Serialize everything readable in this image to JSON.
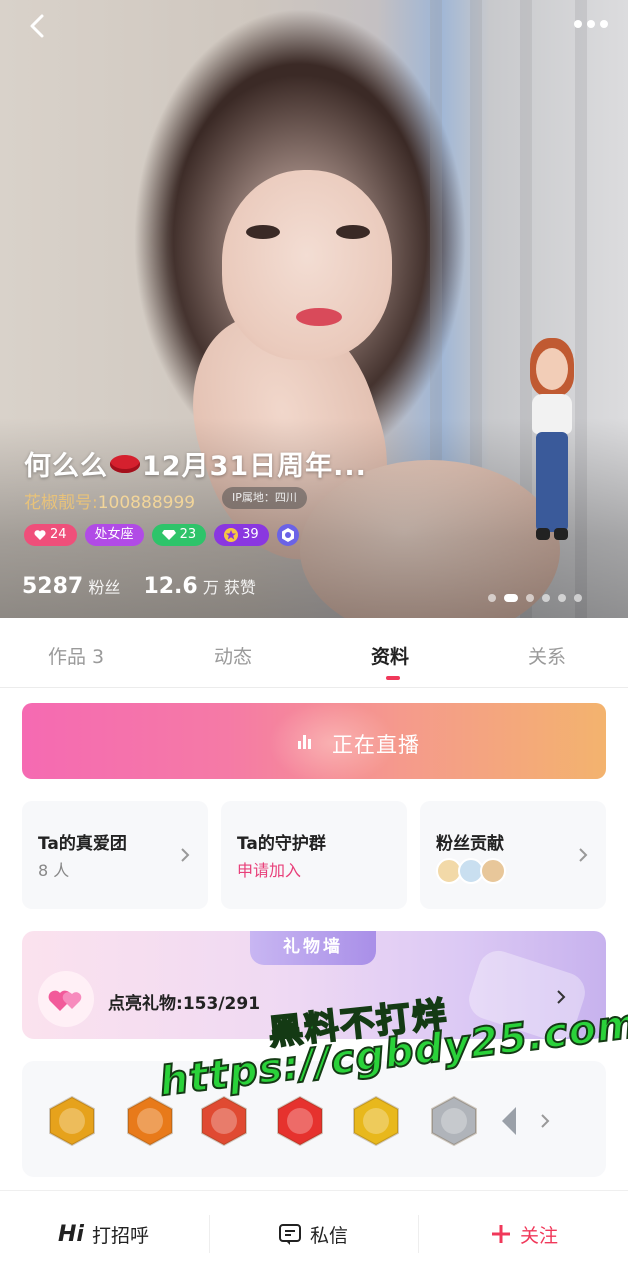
{
  "header": {
    "back_icon": "chevron-left-icon",
    "more_icon": "more-dots-icon"
  },
  "profile": {
    "name_part1": "何么么",
    "name_emoji": "lips",
    "name_part2": "12月31日周年...",
    "id_label": "花椒靓号:",
    "id_value": "100888999",
    "ip_location": "IP属地：四川",
    "badges": [
      {
        "icon": "heart-icon",
        "value": "24",
        "color": "#ef4f7a"
      },
      {
        "icon": "",
        "value": "处女座",
        "color": "#b14be6"
      },
      {
        "icon": "diamond-icon",
        "value": "23",
        "color": "#2ec46a"
      },
      {
        "icon": "star-icon",
        "value": "39",
        "color": "#8a37e0"
      }
    ],
    "fans_count": "5287",
    "fans_label": "粉丝",
    "likes_count": "12.6",
    "likes_label": "万 获赞",
    "carousel_total": 6,
    "carousel_active": 2
  },
  "tabs": [
    {
      "label": "作品 3",
      "active": false
    },
    {
      "label": "动态",
      "active": false
    },
    {
      "label": "资料",
      "active": true
    },
    {
      "label": "关系",
      "active": false
    }
  ],
  "live": {
    "label": "正在直播"
  },
  "cards": {
    "fan_club": {
      "title": "Ta的真爱团",
      "sub": "8 人"
    },
    "guard_group": {
      "title": "Ta的守护群",
      "sub": "申请加入"
    },
    "fan_contrib": {
      "title": "粉丝贡献"
    }
  },
  "gift_wall": {
    "tag": "礼物墙",
    "label": "点亮礼物:",
    "lit": "153",
    "total": "291"
  },
  "medals": [
    {
      "name": "gold-medal-1",
      "color": "#e6a21c"
    },
    {
      "name": "orange-medal",
      "color": "#e87a1a"
    },
    {
      "name": "red-medal",
      "color": "#e04a32"
    },
    {
      "name": "heart-medal",
      "color": "#e6322e"
    },
    {
      "name": "gold-coin-medal",
      "color": "#e8b81c"
    },
    {
      "name": "silver-medal",
      "color": "#b0b4ba"
    },
    {
      "name": "diamond-medal",
      "color": "#9aa0a8"
    }
  ],
  "watermark": {
    "line1": "黑料不打烊",
    "line2": "https://cgbdy25.com"
  },
  "bottom_bar": {
    "greet_prefix": "Hi",
    "greet_label": "打招呼",
    "message_label": "私信",
    "follow_label": "关注"
  },
  "colors": {
    "accent": "#f0385a",
    "pink_text": "#e8407a",
    "watermark_green": "#2ad23a"
  }
}
